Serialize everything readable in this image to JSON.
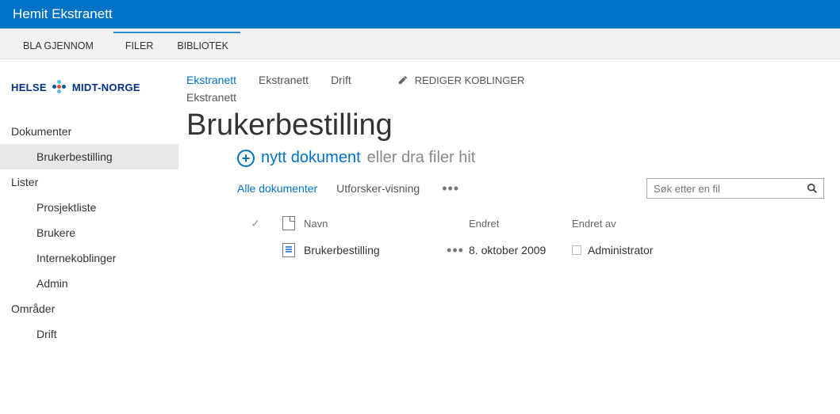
{
  "topbar": {
    "title": "Hemit Ekstranett"
  },
  "ribbon": {
    "tabs": [
      {
        "label": "BLA GJENNOM"
      },
      {
        "label": "FILER"
      },
      {
        "label": "BIBLIOTEK"
      }
    ]
  },
  "logo": {
    "left": "HELSE",
    "right": "MIDT-NORGE"
  },
  "sidebar": {
    "groups": [
      {
        "heading": "Dokumenter",
        "items": [
          {
            "label": "Brukerbestilling",
            "selected": true
          }
        ]
      },
      {
        "heading": "Lister",
        "items": [
          {
            "label": "Prosjektliste"
          },
          {
            "label": "Brukere"
          },
          {
            "label": "Internekoblinger"
          },
          {
            "label": "Admin"
          }
        ]
      },
      {
        "heading": "Områder",
        "items": [
          {
            "label": "Drift"
          }
        ]
      }
    ]
  },
  "breadcrumb": {
    "items": [
      {
        "text": "Ekstranett",
        "link": true
      },
      {
        "text": "Ekstranett"
      },
      {
        "text": "Drift"
      }
    ],
    "edit_links": "REDIGER KOBLINGER",
    "row2": [
      {
        "text": "Ekstranett"
      }
    ]
  },
  "page": {
    "title": "Brukerbestilling"
  },
  "newdoc": {
    "link": "nytt dokument",
    "hint": "eller dra filer hit"
  },
  "views": {
    "all": "Alle dokumenter",
    "explorer": "Utforsker-visning",
    "more": "•••"
  },
  "search": {
    "placeholder": "Søk etter en fil"
  },
  "table": {
    "headers": {
      "name": "Navn",
      "modified": "Endret",
      "modified_by": "Endret av"
    },
    "rows": [
      {
        "name": "Brukerbestilling",
        "modified": "8. oktober 2009",
        "modified_by": "Administrator"
      }
    ]
  }
}
